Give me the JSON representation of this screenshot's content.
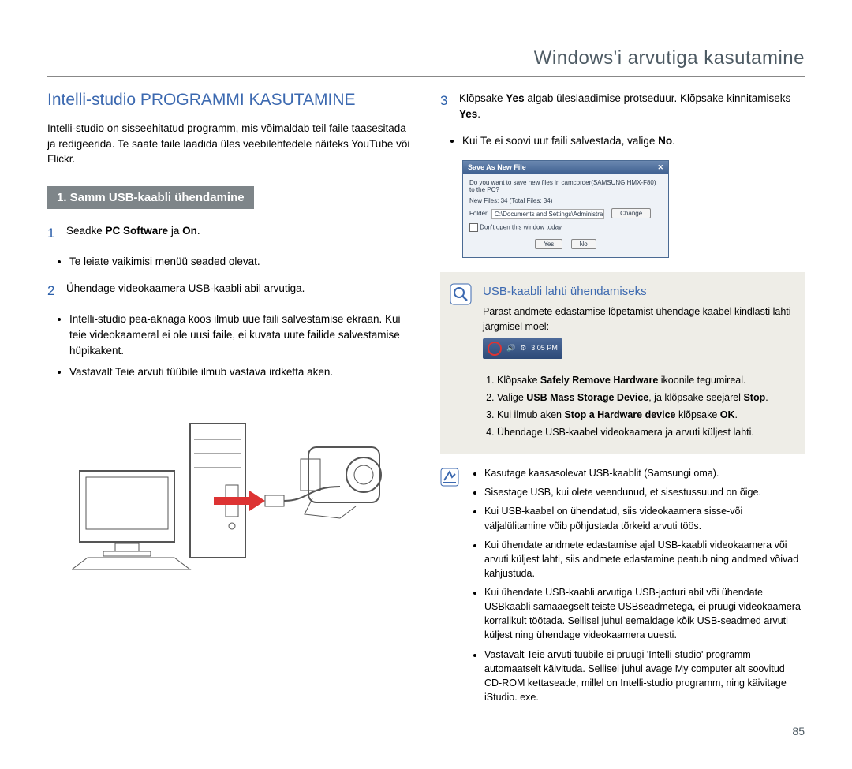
{
  "header": {
    "title": "Windows'i arvutiga kasutamine"
  },
  "left": {
    "heading": "Intelli-studio PROGRAMMI KASUTAMINE",
    "intro": "Intelli-studio on sisseehitatud programm, mis võimaldab teil faile taasesitada ja redigeerida. Te saate faile laadida üles veebilehtedele näiteks YouTube või Flickr.",
    "step_bar": "1. Samm USB-kaabli ühendamine",
    "s1_num": "1",
    "s1_text_a": "Seadke ",
    "s1_text_b": "PC Software",
    "s1_text_c": " ja ",
    "s1_text_d": "On",
    "s1_text_e": ".",
    "s1_b1": "Te leiate vaikimisi menüü seaded olevat.",
    "s2_num": "2",
    "s2_text": "Ühendage videokaamera USB-kaabli abil arvutiga.",
    "s2_b1": "Intelli-studio pea-aknaga koos ilmub uue faili salvestamise ekraan. Kui teie videokaameral ei ole uusi faile, ei kuvata uute failide salvestamise hüpikakent.",
    "s2_b2": "Vastavalt Teie arvuti tüübile ilmub vastava irdketta aken."
  },
  "right": {
    "s3_num": "3",
    "s3_a": "Klõpsake ",
    "s3_b": "Yes",
    "s3_c": " algab üleslaadimise protseduur. Klõpsake kinnitamiseks ",
    "s3_d": "Yes",
    "s3_e": ".",
    "s3_b1_a": "Kui Te ei soovi uut faili salvestada, valige ",
    "s3_b1_b": "No",
    "s3_b1_c": ".",
    "dialog": {
      "title": "Save As New File",
      "q": "Do you want to save new files in camcorder(SAMSUNG HMX-F80) to the PC?",
      "row_new": "New Files: 34 (Total Files: 34)",
      "row_folder_label": "Folder",
      "row_folder_path": "C:\\Documents and Settings\\Administrator\\My Documents\\Intelli-s",
      "change": "Change",
      "checkbox": "Don't open this window today",
      "yes": "Yes",
      "no": "No"
    },
    "info": {
      "title": "USB-kaabli lahti ühendamiseks",
      "p": "Pärast andmete edastamise lõpetamist ühendage kaabel kindlasti lahti järgmisel moel:",
      "time": "3:05 PM",
      "li1_a": "Klõpsake ",
      "li1_b": "Safely Remove Hardware",
      "li1_c": " ikoonile tegumireal.",
      "li2_a": "Valige ",
      "li2_b": "USB Mass Storage Device",
      "li2_c": ", ja klõpsake seejärel ",
      "li2_d": "Stop",
      "li2_e": ".",
      "li3_a": "Kui ilmub aken ",
      "li3_b": "Stop a Hardware device",
      "li3_c": " klõpsake ",
      "li3_d": "OK",
      "li3_e": ".",
      "li4": "Ühendage USB-kaabel videokaamera ja arvuti küljest lahti."
    },
    "notes": {
      "n1": "Kasutage kaasasolevat USB-kaablit (Samsungi oma).",
      "n2": "Sisestage USB, kui olete veendunud, et sisestussuund on õige.",
      "n3": "Kui USB-kaabel on ühendatud, siis videokaamera sisse-või väljalülitamine võib põhjustada tõrkeid arvuti töös.",
      "n4": "Kui ühendate andmete edastamise ajal USB-kaabli videokaamera või arvuti küljest lahti, siis andmete edastamine peatub ning andmed võivad kahjustuda.",
      "n5": "Kui ühendate USB-kaabli arvutiga USB-jaoturi abil või ühendate USBkaabli samaaegselt teiste USBseadmetega, ei pruugi videokaamera korralikult töötada. Sellisel juhul eemaldage kõik USB-seadmed arvuti küljest ning ühendage videokaamera uuesti.",
      "n6": "Vastavalt Teie arvuti tüübile ei pruugi 'Intelli-studio' programm automaatselt käivituda. Sellisel juhul avage My computer alt soovitud CD-ROM kettaseade, millel on Intelli-studio programm, ning käivitage iStudio. exe."
    }
  },
  "pagenum": "85"
}
